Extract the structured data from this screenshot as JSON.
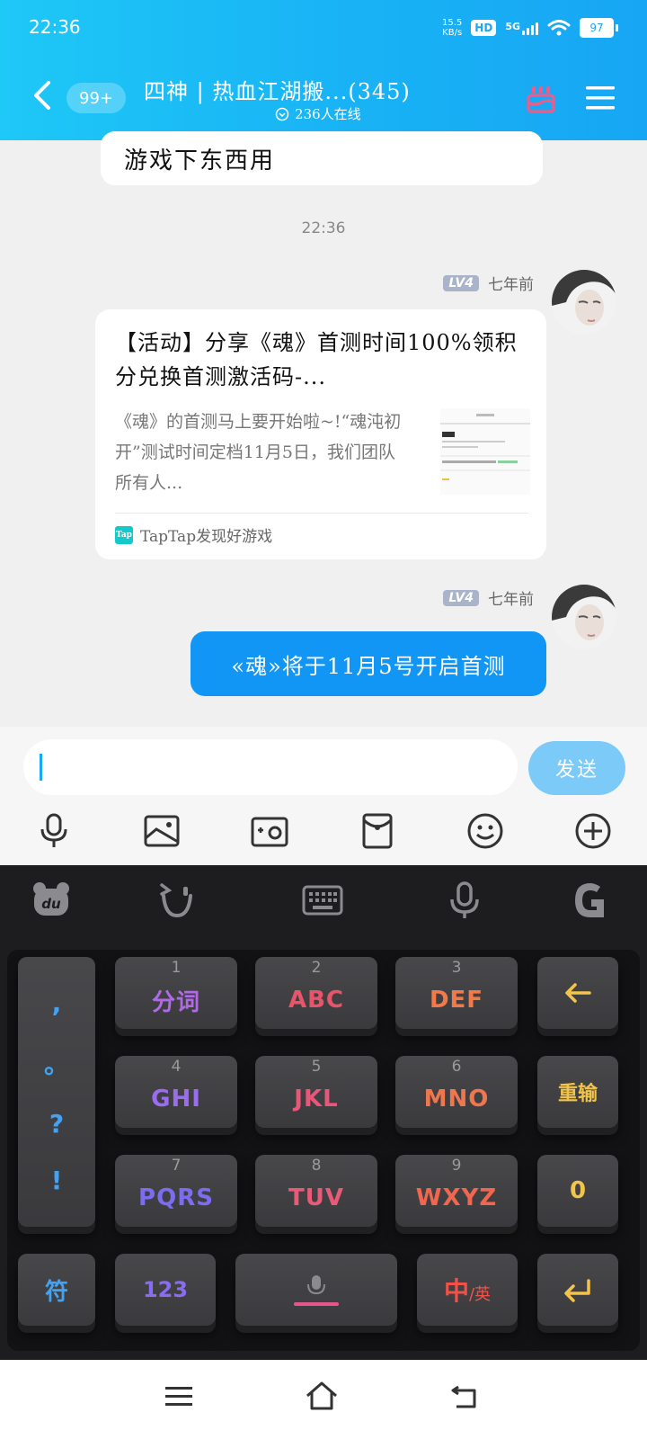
{
  "status_bar": {
    "time": "22:36",
    "net_speed_value": "15.5",
    "net_speed_unit": "KB/s",
    "hd": "HD",
    "network": "5G",
    "battery": "97"
  },
  "header": {
    "badge": "99+",
    "title": "四神 | 热血江湖搬...(345)",
    "online": "236人在线"
  },
  "chat": {
    "prev_message": "游戏下东西用",
    "time_separator": "22:36",
    "messages": [
      {
        "level": "LV4",
        "meta_time": "七年前",
        "card_title": "【活动】分享《魂》首测时间100%领积分兑换首测激活码-...",
        "card_desc": "《魂》的首测马上要开始啦~!“魂沌初开”测试时间定档11月5日，我们团队所有人...",
        "card_source": "TapTap发现好游戏",
        "tap_logo": "Tap"
      },
      {
        "level": "LV4",
        "meta_time": "七年前",
        "text": "«魂»将于11月5号开启首测"
      }
    ]
  },
  "input": {
    "value": "",
    "send_label": "发送"
  },
  "keyboard": {
    "left_column": [
      ",",
      "。",
      "?",
      "!"
    ],
    "keys": [
      {
        "num": "1",
        "label": "分词",
        "color": "#b06ae8"
      },
      {
        "num": "2",
        "label": "ABC",
        "color": "#e8556b"
      },
      {
        "num": "3",
        "label": "DEF",
        "color": "#f07a4a"
      },
      {
        "num": "4",
        "label": "GHI",
        "color": "#9a6cf0"
      },
      {
        "num": "5",
        "label": "JKL",
        "color": "#e8567a"
      },
      {
        "num": "6",
        "label": "MNO",
        "color": "#f0764e"
      },
      {
        "num": "7",
        "label": "PQRS",
        "color": "#7c6cf0"
      },
      {
        "num": "8",
        "label": "TUV",
        "color": "#e85a78"
      },
      {
        "num": "9",
        "label": "WXYZ",
        "color": "#f0664e"
      }
    ],
    "reinput": "重输",
    "zero": "0",
    "symbols": "符",
    "numbers": "123",
    "lang_main": "中",
    "lang_alt": "/英",
    "colors": {
      "blue": "#45a2f0",
      "yellow": "#f2c44a",
      "purple": "#8a6cf0",
      "red": "#f0524a",
      "pink": "#e8558a"
    }
  }
}
